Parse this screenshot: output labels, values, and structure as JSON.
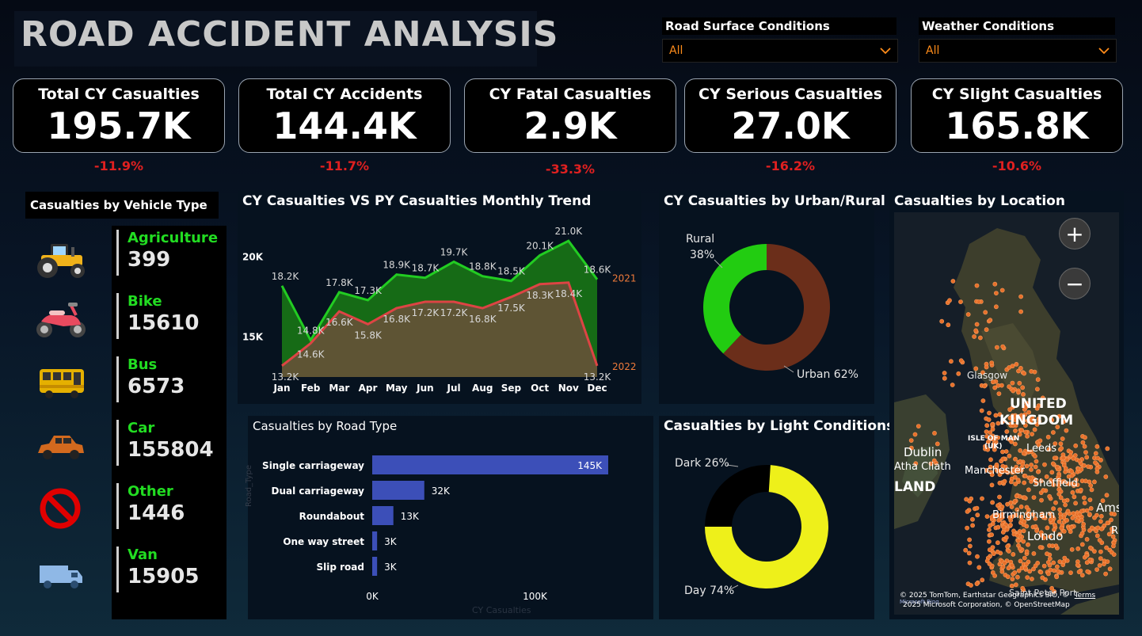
{
  "title": "ROAD ACCIDENT ANALYSIS",
  "slicers": {
    "road_surface": {
      "label": "Road Surface Conditions",
      "value": "All"
    },
    "weather": {
      "label": "Weather Conditions",
      "value": "All"
    }
  },
  "kpis": [
    {
      "label": "Total CY Casualties",
      "value": "195.7K",
      "delta": "-11.9%"
    },
    {
      "label": "Total CY Accidents",
      "value": "144.4K",
      "delta": "-11.7%"
    },
    {
      "label": "CY Fatal Casualties",
      "value": "2.9K",
      "delta": "-33.3%"
    },
    {
      "label": "CY Serious Casualties",
      "value": "27.0K",
      "delta": "-16.2%"
    },
    {
      "label": "CY Slight Casualties",
      "value": "165.8K",
      "delta": "-10.6%"
    }
  ],
  "vehicles": {
    "title": "Casualties by Vehicle Type",
    "items": [
      {
        "name": "Agriculture",
        "value": "399",
        "icon": "tractor-icon"
      },
      {
        "name": "Bike",
        "value": "15610",
        "icon": "motorbike-icon"
      },
      {
        "name": "Bus",
        "value": "6573",
        "icon": "bus-icon"
      },
      {
        "name": "Car",
        "value": "155804",
        "icon": "car-icon"
      },
      {
        "name": "Other",
        "value": "1446",
        "icon": "prohibited-icon"
      },
      {
        "name": "Van",
        "value": "15905",
        "icon": "van-icon"
      }
    ]
  },
  "trend": {
    "title": "CY Casualties VS PY Casualties Monthly Trend",
    "series_cy_label": "2021",
    "series_py_label": "2022"
  },
  "urban_rural": {
    "title": "CY Casualties by Urban/Rural",
    "rural_label": "Rural",
    "rural_pct": "38%",
    "urban_label": "Urban 62%"
  },
  "road_type": {
    "title": "Casualties by Road Type",
    "y_axis_title": "Road_Type",
    "x_axis_title": "CY Casualties"
  },
  "light": {
    "title": "Casualties by Light Conditions",
    "dark_label": "Dark 26%",
    "day_label": "Day 74%"
  },
  "location": {
    "title": "Casualties by Location",
    "zoom_in": "+",
    "zoom_out": "−",
    "labels": {
      "glasgow": "Glasgow",
      "uk1": "UNITED",
      "uk2": "KINGDOM",
      "iom1": "ISLE OF MAN",
      "iom2": "(UK)",
      "dublin": "Dublin",
      "atha": "Atha Cliath",
      "land": "LAND",
      "manchester": "Manchester",
      "leeds": "Leeds",
      "sheffield": "Sheffield",
      "birmingham": "Birmingham",
      "london": "Londo",
      "ams": "Ams",
      "r": "R",
      "st_peter": "Saint Peter Port"
    },
    "attribution1": "© 2025 TomTom, Earthstar Geographics SIO, ©",
    "attribution_link": "Terms",
    "attribution2": "2025 Microsoft Corporation, © OpenStreetMap",
    "attribution_tiny": "Microsoft Bing"
  },
  "chart_data": [
    {
      "type": "area",
      "title": "CY Casualties VS PY Casualties Monthly Trend",
      "categories": [
        "Jan",
        "Feb",
        "Mar",
        "Apr",
        "May",
        "Jun",
        "Jul",
        "Aug",
        "Sep",
        "Oct",
        "Nov",
        "Dec"
      ],
      "series": [
        {
          "name": "2021",
          "color": "#22cc22",
          "values": [
            18.2,
            14.8,
            17.8,
            17.3,
            18.9,
            18.7,
            19.7,
            18.8,
            18.5,
            20.1,
            21.0,
            18.6
          ],
          "labels": [
            "18.2K",
            "14.8K",
            "17.8K",
            "17.3K",
            "18.9K",
            "18.7K",
            "19.7K",
            "18.8K",
            "18.5K",
            "20.1K",
            "21.0K",
            "18.6K"
          ]
        },
        {
          "name": "2022",
          "color": "#dd4444",
          "values": [
            13.2,
            14.6,
            16.6,
            15.8,
            16.8,
            17.2,
            17.2,
            16.8,
            17.5,
            18.3,
            18.4,
            13.2
          ],
          "labels": [
            "13.2K",
            "14.6K",
            "16.6K",
            "15.8K",
            "16.8K",
            "17.2K",
            "17.2K",
            "16.8K",
            "17.5K",
            "18.3K",
            "18.4K",
            "13.2K"
          ]
        }
      ],
      "y_ticks": [
        "15K",
        "20K"
      ],
      "ylim": [
        12.5,
        22
      ]
    },
    {
      "type": "pie",
      "title": "CY Casualties by Urban/Rural",
      "slices": [
        {
          "name": "Rural",
          "value": 38,
          "color": "#22cc11"
        },
        {
          "name": "Urban",
          "value": 62,
          "color": "#6b2e1a"
        }
      ]
    },
    {
      "type": "bar",
      "title": "Casualties by Road Type",
      "categories": [
        "Single carriageway",
        "Dual carriageway",
        "Roundabout",
        "One way street",
        "Slip road"
      ],
      "values": [
        145,
        32,
        13,
        3,
        3
      ],
      "labels": [
        "145K",
        "32K",
        "13K",
        "3K",
        "3K"
      ],
      "x_ticks": [
        "0K",
        "100K"
      ],
      "xlim": [
        0,
        145
      ],
      "color": "#3c4fb8",
      "xlabel": "CY Casualties",
      "ylabel": "Road_Type"
    },
    {
      "type": "pie",
      "title": "Casualties by Light Conditions",
      "slices": [
        {
          "name": "Dark",
          "value": 26,
          "color": "#000000"
        },
        {
          "name": "Day",
          "value": 74,
          "color": "#eef01a"
        }
      ]
    }
  ]
}
